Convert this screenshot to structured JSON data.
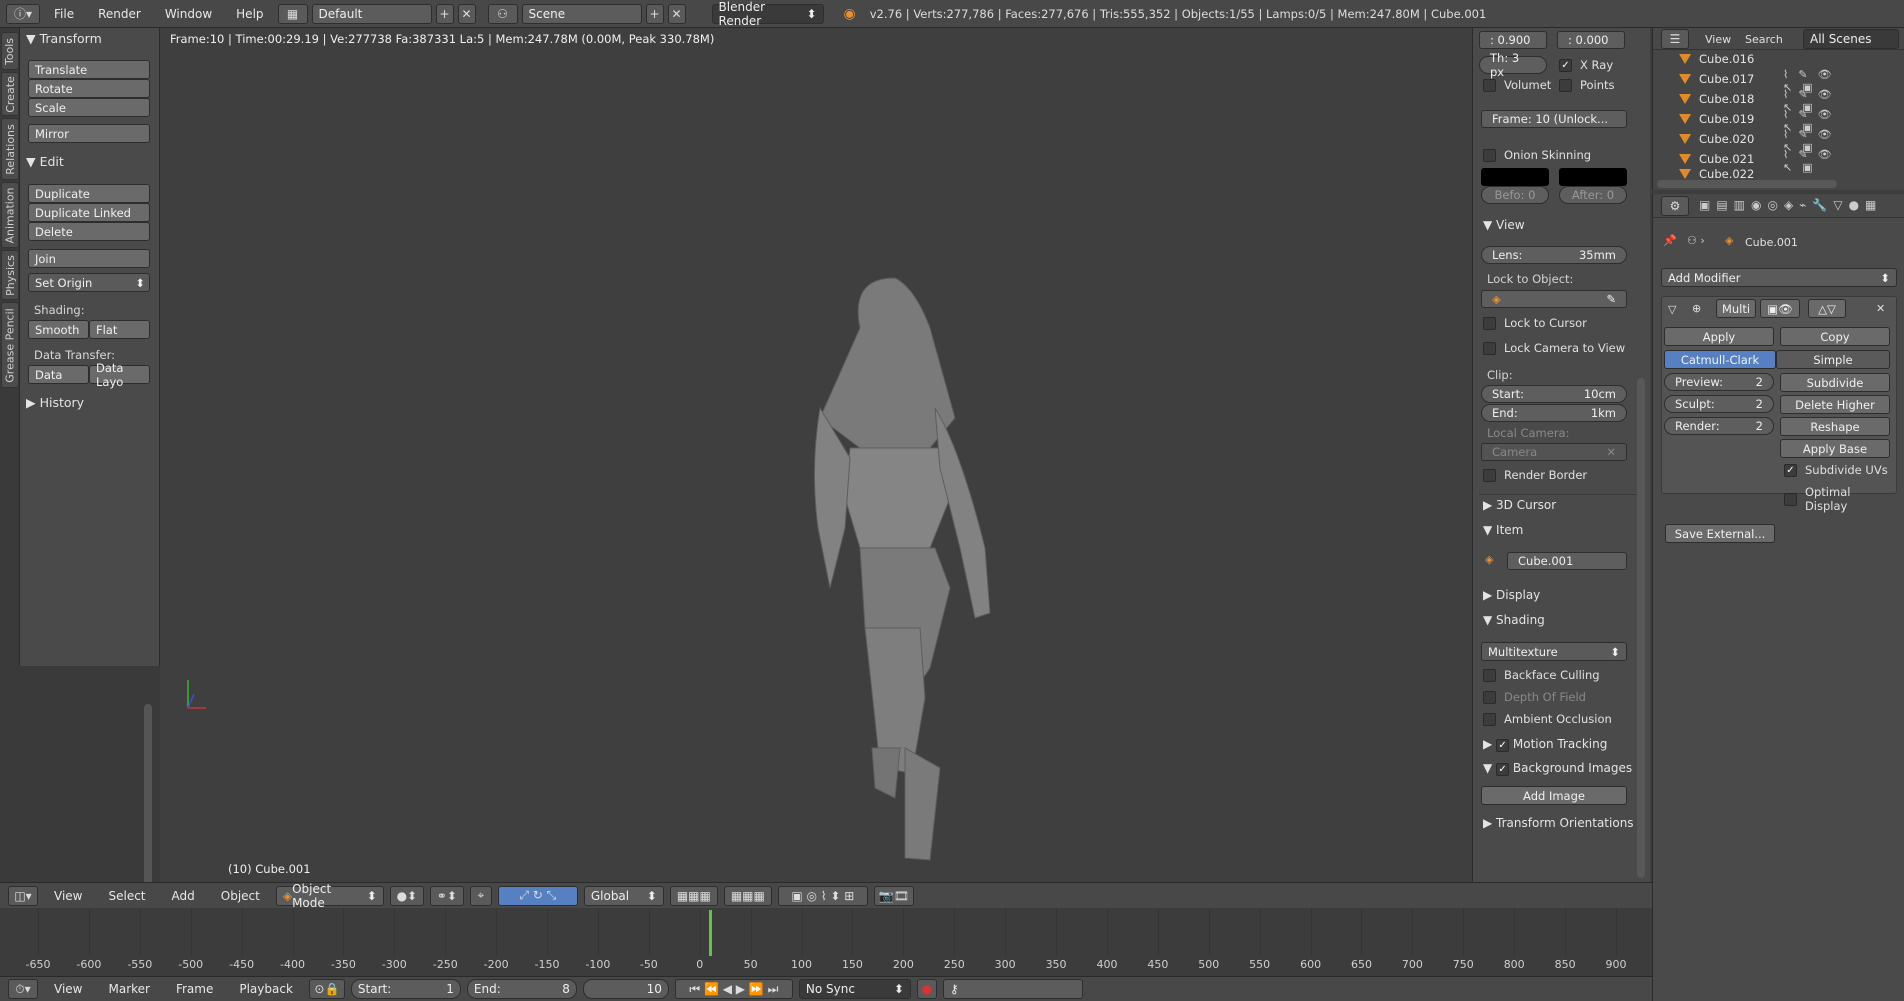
{
  "top": {
    "menus": [
      "File",
      "Render",
      "Window",
      "Help"
    ],
    "layout": "Default",
    "scene": "Scene",
    "engine": "Blender Render",
    "stats": "v2.76 | Verts:277,786 | Faces:277,676 | Tris:555,352 | Objects:1/55 | Lamps:0/5 | Mem:247.80M | Cube.001"
  },
  "tool_tabs": [
    "Tools",
    "Create",
    "Relations",
    "Animation",
    "Physics",
    "Grease Pencil"
  ],
  "tools": {
    "transform_header": "Transform",
    "translate": "Translate",
    "rotate": "Rotate",
    "scale": "Scale",
    "mirror": "Mirror",
    "edit_header": "Edit",
    "duplicate": "Duplicate",
    "duplicate_linked": "Duplicate Linked",
    "delete": "Delete",
    "join": "Join",
    "set_origin": "Set Origin",
    "shading_label": "Shading:",
    "smooth": "Smooth",
    "flat": "Flat",
    "data_transfer_label": "Data Transfer:",
    "data": "Data",
    "data_layo": "Data Layo",
    "history_header": "History"
  },
  "viewport": {
    "info": "Frame:10 | Time:00:29.19 | Ve:277738 Fa:387331 La:5 | Mem:247.78M (0.00M, Peak 330.78M)",
    "object_label": "(10) Cube.001"
  },
  "npanel": {
    "val1": ": 0.900",
    "val2": ": 0.000",
    "th": "Th: 3 px",
    "xray": "X Ray",
    "volumet": "Volumet",
    "points": "Points",
    "frame": "Frame: 10 (Unlock...",
    "onion": "Onion Skinning",
    "before": "Befo: 0",
    "after": "After: 0",
    "view_header": "View",
    "lens_label": "Lens:",
    "lens_value": "35mm",
    "lock_obj": "Lock to Object:",
    "lock_cursor": "Lock to Cursor",
    "lock_cam": "Lock Camera to View",
    "clip": "Clip:",
    "start_label": "Start:",
    "start_value": "10cm",
    "end_label": "End:",
    "end_value": "1km",
    "local_cam": "Local Camera:",
    "camera": "Camera",
    "render_border": "Render Border",
    "cursor_header": "3D Cursor",
    "item_header": "Item",
    "item_name": "Cube.001",
    "display_header": "Display",
    "shading_header": "Shading",
    "multitexture": "Multitexture",
    "backface": "Backface Culling",
    "dof": "Depth Of Field",
    "ao": "Ambient Occlusion",
    "motion": "Motion Tracking",
    "bg_images": "Background Images",
    "add_image": "Add Image",
    "transform_orient": "Transform Orientations"
  },
  "outliner": {
    "view": "View",
    "search": "Search",
    "scenes": "All Scenes",
    "items": [
      "Cube.016",
      "Cube.017",
      "Cube.018",
      "Cube.019",
      "Cube.020",
      "Cube.021",
      "Cube.022"
    ]
  },
  "properties": {
    "object": "Cube.001",
    "add_modifier": "Add Modifier",
    "mod_name": "Multi",
    "apply": "Apply",
    "copy": "Copy",
    "catmull": "Catmull-Clark",
    "simple": "Simple",
    "preview_label": "Preview:",
    "preview_value": "2",
    "sculpt_label": "Sculpt:",
    "sculpt_value": "2",
    "render_label": "Render:",
    "render_value": "2",
    "subdivide": "Subdivide",
    "delete_higher": "Delete Higher",
    "reshape": "Reshape",
    "apply_base": "Apply Base",
    "subdivide_uvs": "Subdivide UVs",
    "optimal_display": "Optimal Display",
    "save_external": "Save External..."
  },
  "vp_header": {
    "view": "View",
    "select": "Select",
    "add": "Add",
    "object": "Object",
    "mode": "Object Mode",
    "orientation": "Global"
  },
  "timeline": {
    "ticks": [
      "-650",
      "-600",
      "-550",
      "-500",
      "-450",
      "-400",
      "-350",
      "-300",
      "-250",
      "-200",
      "-150",
      "-100",
      "-50",
      "0",
      "50",
      "100",
      "150",
      "200",
      "250",
      "300",
      "350",
      "400",
      "450",
      "500",
      "550",
      "600",
      "650",
      "700",
      "750",
      "800",
      "850",
      "900"
    ],
    "current_frame": 10
  },
  "tl_header": {
    "view": "View",
    "marker": "Marker",
    "frame": "Frame",
    "playback": "Playback",
    "start_label": "Start:",
    "start_value": "1",
    "end_label": "End:",
    "end_value": "8",
    "current": "10",
    "sync": "No Sync"
  }
}
